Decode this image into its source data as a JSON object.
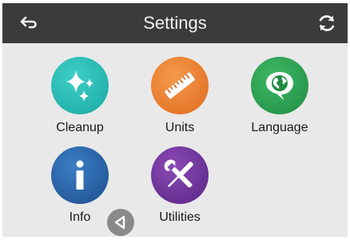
{
  "header": {
    "title": "Settings",
    "back_icon": "back-arrow-icon",
    "refresh_icon": "refresh-icon"
  },
  "tiles": [
    {
      "label": "Cleanup",
      "icon": "sparkle-icon",
      "color": "#1aa7a2"
    },
    {
      "label": "Units",
      "icon": "ruler-icon",
      "color": "#e06a1f"
    },
    {
      "label": "Language",
      "icon": "globe-speech-icon",
      "color": "#1f8c44"
    },
    {
      "label": "Info",
      "icon": "info-icon",
      "color": "#1c4e8f"
    },
    {
      "label": "Utilities",
      "icon": "tools-icon",
      "color": "#5a2585"
    }
  ],
  "pager": {
    "prev_icon": "triangle-left-icon"
  },
  "colors": {
    "header_bg": "#3b3b3b",
    "screen_bg": "#e9e9e9"
  }
}
